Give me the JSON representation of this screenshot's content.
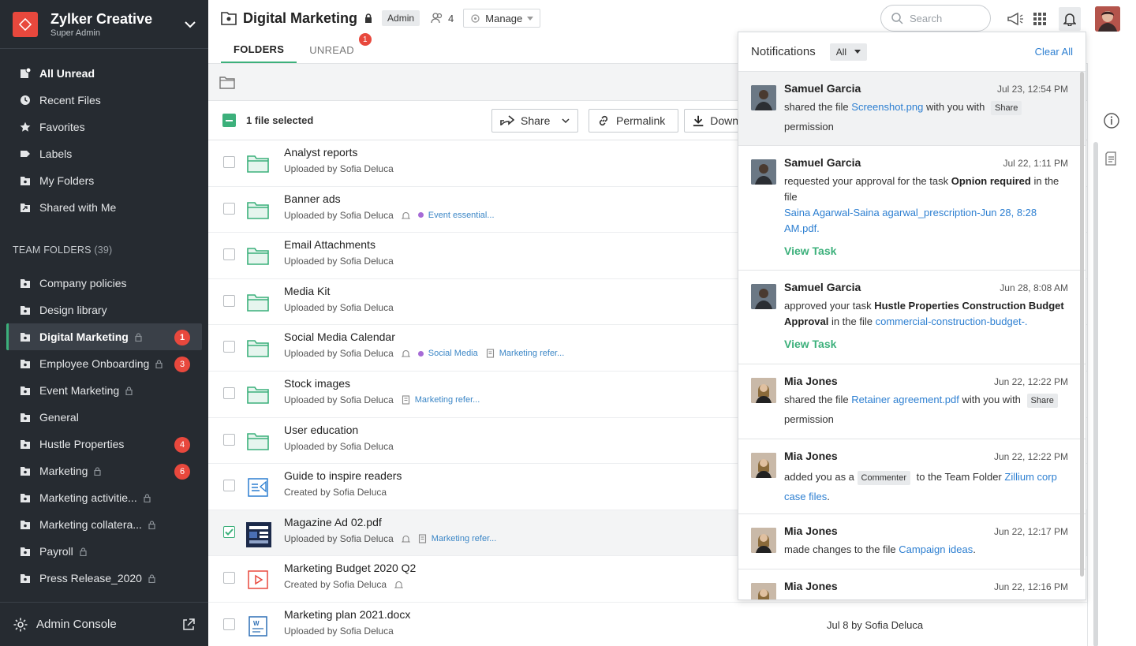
{
  "org": {
    "name": "Zylker Creative",
    "role": "Super Admin"
  },
  "nav": [
    {
      "label": "All Unread",
      "icon": "all-unread-icon"
    },
    {
      "label": "Recent Files",
      "icon": "clock-icon"
    },
    {
      "label": "Favorites",
      "icon": "star-icon"
    },
    {
      "label": "Labels",
      "icon": "label-icon"
    },
    {
      "label": "My Folders",
      "icon": "folder-icon"
    },
    {
      "label": "Shared with Me",
      "icon": "shared-folder-icon"
    }
  ],
  "team": {
    "header": "TEAM FOLDERS",
    "count": "(39)"
  },
  "team_folders": [
    {
      "label": "Company policies",
      "lock": false,
      "badge": ""
    },
    {
      "label": "Design library",
      "lock": false,
      "badge": ""
    },
    {
      "label": "Digital Marketing",
      "lock": true,
      "badge": "1"
    },
    {
      "label": "Employee Onboarding",
      "lock": true,
      "badge": "3"
    },
    {
      "label": "Event Marketing",
      "lock": true,
      "badge": ""
    },
    {
      "label": "General",
      "lock": false,
      "badge": ""
    },
    {
      "label": "Hustle Properties",
      "lock": false,
      "badge": "4"
    },
    {
      "label": "Marketing",
      "lock": true,
      "badge": "6"
    },
    {
      "label": "Marketing activitie...",
      "lock": true,
      "badge": ""
    },
    {
      "label": "Marketing collatera...",
      "lock": true,
      "badge": ""
    },
    {
      "label": "Payroll",
      "lock": true,
      "badge": ""
    },
    {
      "label": "Press Release_2020",
      "lock": true,
      "badge": ""
    }
  ],
  "admin_console": "Admin Console",
  "header": {
    "title": "Digital Marketing",
    "admin_tag": "Admin",
    "members": "4",
    "manage": "Manage",
    "search_placeholder": "Search"
  },
  "tabs": [
    {
      "label": "FOLDERS"
    },
    {
      "label": "UNREAD",
      "badge": "1"
    }
  ],
  "selection": {
    "text": "1 file selected",
    "share": "Share",
    "permalink": "Permalink",
    "download": "Down"
  },
  "files": [
    {
      "name": "Analyst reports",
      "sub": "Uploaded by Sofia Deluca",
      "type": "folder"
    },
    {
      "name": "Banner ads",
      "sub": "Uploaded by Sofia Deluca",
      "type": "folder",
      "bell": true,
      "label": "Event essential..."
    },
    {
      "name": "Email Attachments",
      "sub": "Uploaded by Sofia Deluca",
      "type": "folder"
    },
    {
      "name": "Media Kit",
      "sub": "Uploaded by Sofia Deluca",
      "type": "folder"
    },
    {
      "name": "Social Media Calendar",
      "sub": "Uploaded by Sofia Deluca",
      "type": "folder",
      "bell": true,
      "label": "Social Media",
      "ref": "Marketing refer..."
    },
    {
      "name": "Stock images",
      "sub": "Uploaded by Sofia Deluca",
      "type": "folder",
      "ref": "Marketing refer..."
    },
    {
      "name": "User education",
      "sub": "Uploaded by Sofia Deluca",
      "type": "folder"
    },
    {
      "name": "Guide to inspire readers",
      "sub": "Created by Sofia Deluca",
      "type": "writer"
    },
    {
      "name": "Magazine Ad 02.pdf",
      "sub": "Uploaded by Sofia Deluca",
      "type": "pdf",
      "bell": true,
      "ref": "Marketing refer...",
      "selected": true
    },
    {
      "name": "Marketing Budget 2020 Q2",
      "sub": "Created by Sofia Deluca",
      "type": "show",
      "bell": true
    },
    {
      "name": "Marketing plan 2021.docx",
      "sub": "Uploaded by Sofia Deluca",
      "type": "doc",
      "right": "Jul 8 by Sofia Deluca"
    }
  ],
  "notifications": {
    "title": "Notifications",
    "filter": "All",
    "clear": "Clear All",
    "view_task": "View Task",
    "items": [
      {
        "name": "Samuel Garcia",
        "time": "Jul 23, 12:54 PM"
      },
      {
        "name": "Samuel Garcia",
        "time": "Jul 22, 1:11 PM"
      },
      {
        "name": "Samuel Garcia",
        "time": "Jun 28, 8:08 AM"
      },
      {
        "name": "Mia Jones",
        "time": "Jun 22, 12:22 PM"
      },
      {
        "name": "Mia Jones",
        "time": "Jun 22, 12:22 PM"
      },
      {
        "name": "Mia Jones",
        "time": "Jun 22, 12:17 PM"
      },
      {
        "name": "Mia Jones",
        "time": "Jun 22, 12:16 PM"
      }
    ],
    "n1": {
      "a": "shared the file ",
      "file": "Screenshot.png",
      "b": " with you with ",
      "chip": "Share",
      "c": "permission"
    },
    "n2": {
      "a": "requested your approval for the task ",
      "task": "Opnion required",
      "b": " in the file",
      "file": "Saina Agarwal-Saina agarwal_prescription-Jun 28, 8:28 AM.pdf."
    },
    "n3": {
      "a": "approved your task ",
      "task": "Hustle Properties Construction Budget Approval",
      "b": " in the file ",
      "file": "commercial-construction-budget-."
    },
    "n4": {
      "a": "shared the file ",
      "file": "Retainer agreement.pdf",
      "b": " with you with ",
      "chip": "Share",
      "c": "permission"
    },
    "n5": {
      "a": "added you as a ",
      "chip": "Commenter",
      "b": " to the Team Folder ",
      "file": "Zillium corp case files",
      "c": "."
    },
    "n6": {
      "a": "made changes to the file ",
      "file": "Campaign ideas",
      "c": "."
    }
  },
  "colors": {
    "accent": "#3cb07b",
    "badge": "#e8483d",
    "link": "#2d7fd1",
    "sidebar": "#262b31"
  }
}
